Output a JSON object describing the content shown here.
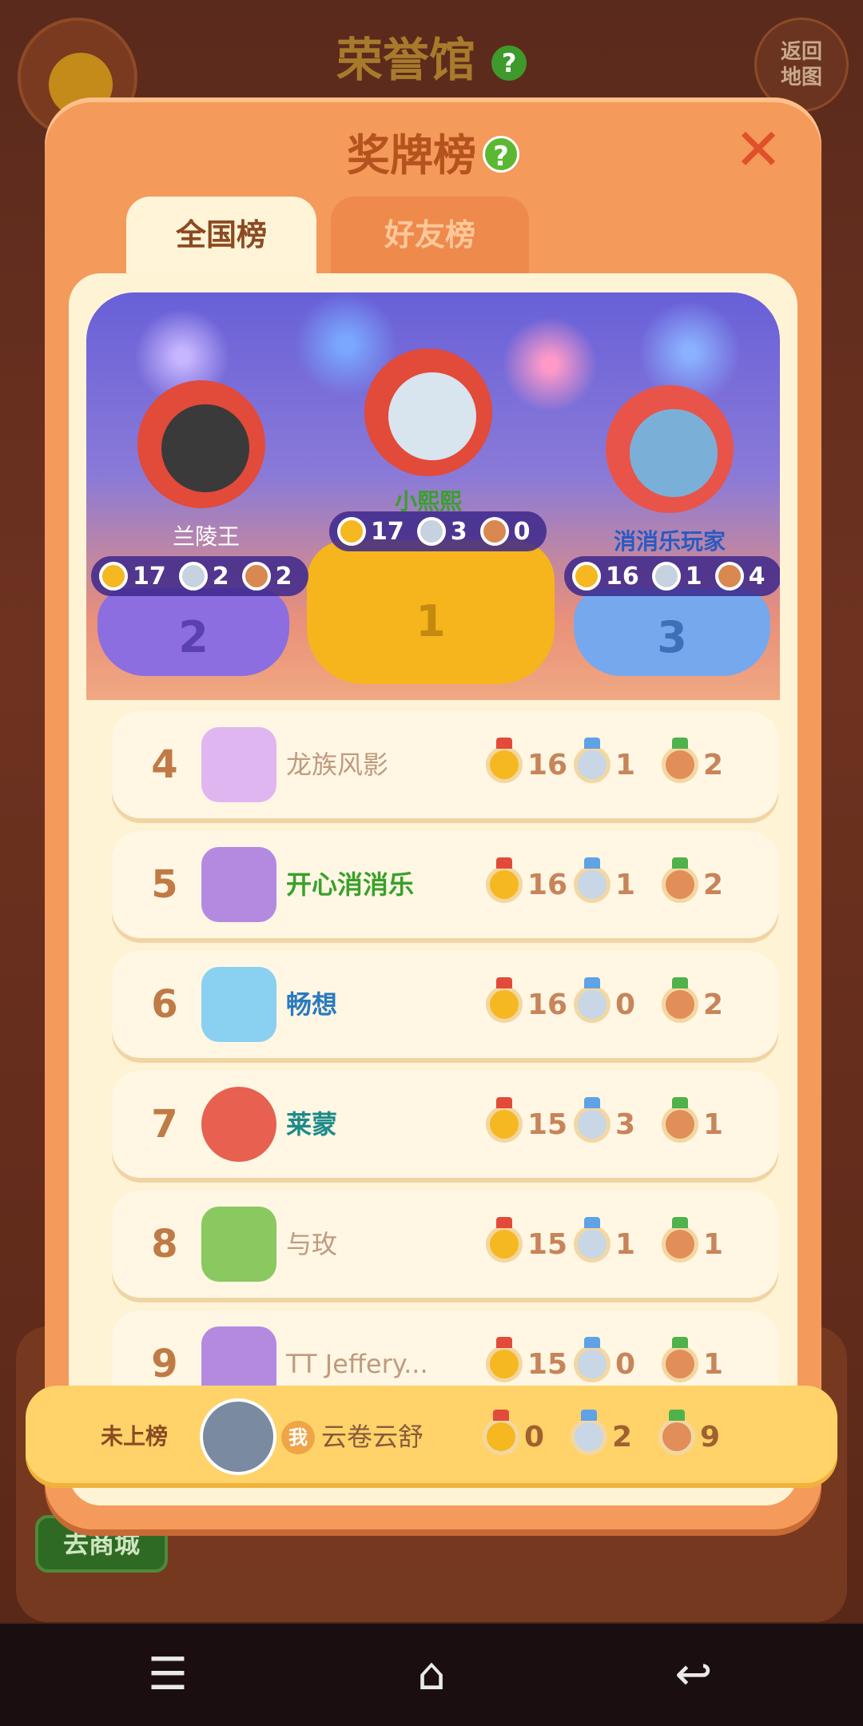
{
  "background": {
    "title": "荣誉馆",
    "title_help": "?",
    "return_button": "返回\n地图",
    "shop_button": "去商城"
  },
  "modal": {
    "title": "奖牌榜",
    "help": "?",
    "close": "✕",
    "tabs": [
      {
        "label": "全国榜",
        "active": true
      },
      {
        "label": "好友榜",
        "active": false
      }
    ]
  },
  "podium": [
    {
      "rank": "2",
      "name": "兰陵王",
      "gold": "17",
      "silver": "2",
      "bronze": "2"
    },
    {
      "rank": "1",
      "name": "小熙熙",
      "gold": "17",
      "silver": "3",
      "bronze": "0"
    },
    {
      "rank": "3",
      "name": "消消乐玩家",
      "gold": "16",
      "silver": "1",
      "bronze": "4"
    }
  ],
  "list": [
    {
      "rank": "4",
      "name": "龙族风影",
      "gold": "16",
      "silver": "1",
      "bronze": "2",
      "name_color": "#c09a7e"
    },
    {
      "rank": "5",
      "name": "开心消消乐",
      "gold": "16",
      "silver": "1",
      "bronze": "2",
      "name_color": "#3aa02a"
    },
    {
      "rank": "6",
      "name": "畅想",
      "gold": "16",
      "silver": "0",
      "bronze": "2",
      "name_color": "#2a7ac0"
    },
    {
      "rank": "7",
      "name": "莱蒙",
      "gold": "15",
      "silver": "3",
      "bronze": "1",
      "name_color": "#1e8a8a"
    },
    {
      "rank": "8",
      "name": "与玫",
      "gold": "15",
      "silver": "1",
      "bronze": "1",
      "name_color": "#c09a7e"
    },
    {
      "rank": "9",
      "name": "TT Jeffery...",
      "gold": "15",
      "silver": "0",
      "bronze": "1",
      "name_color": "#c09a7e"
    }
  ],
  "me": {
    "status": "未上榜",
    "badge": "我",
    "name": "云卷云舒",
    "gold": "0",
    "silver": "2",
    "bronze": "9"
  },
  "nav": {
    "menu": "☰",
    "home": "⌂",
    "back": "↩"
  },
  "colors": {
    "modal": "#f49a5a",
    "gold": "#f6b820",
    "silver": "#c8d6e6",
    "bronze": "#e28e58"
  }
}
